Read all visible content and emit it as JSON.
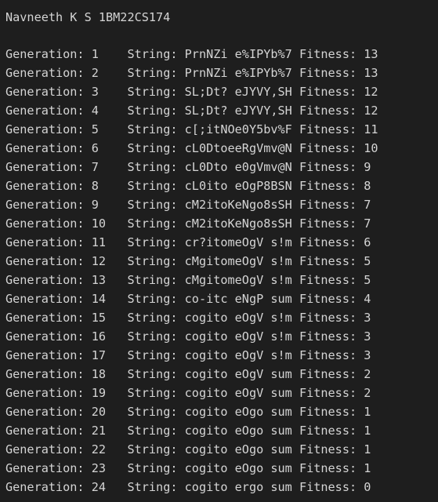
{
  "console": {
    "header": "Navneeth K S 1BM22CS174",
    "rows": [
      {
        "generation": "1",
        "string": "PrnNZi e%IPYb%7",
        "fitness": "13"
      },
      {
        "generation": "2",
        "string": "PrnNZi e%IPYb%7",
        "fitness": "13"
      },
      {
        "generation": "3",
        "string": "SL;Dt? eJYVY,SH",
        "fitness": "12"
      },
      {
        "generation": "4",
        "string": "SL;Dt? eJYVY,SH",
        "fitness": "12"
      },
      {
        "generation": "5",
        "string": "c[;itNOe0Y5bv%F",
        "fitness": "11"
      },
      {
        "generation": "6",
        "string": "cL0DtoeeRgVmv@N",
        "fitness": "10"
      },
      {
        "generation": "7",
        "string": "cL0Dto e0gVmv@N",
        "fitness": "9"
      },
      {
        "generation": "8",
        "string": "cL0ito eOgP8BSN",
        "fitness": "8"
      },
      {
        "generation": "9",
        "string": "cM2itoKeNgo8sSH",
        "fitness": "7"
      },
      {
        "generation": "10",
        "string": "cM2itoKeNgo8sSH",
        "fitness": "7"
      },
      {
        "generation": "11",
        "string": "cr?itomeOgV s!m",
        "fitness": "6"
      },
      {
        "generation": "12",
        "string": "cMgitomeOgV s!m",
        "fitness": "5"
      },
      {
        "generation": "13",
        "string": "cMgitomeOgV s!m",
        "fitness": "5"
      },
      {
        "generation": "14",
        "string": "co-itc eNgP sum",
        "fitness": "4"
      },
      {
        "generation": "15",
        "string": "cogito eOgV s!m",
        "fitness": "3"
      },
      {
        "generation": "16",
        "string": "cogito eOgV s!m",
        "fitness": "3"
      },
      {
        "generation": "17",
        "string": "cogito eOgV s!m",
        "fitness": "3"
      },
      {
        "generation": "18",
        "string": "cogito eOgV sum",
        "fitness": "2"
      },
      {
        "generation": "19",
        "string": "cogito eOgV sum",
        "fitness": "2"
      },
      {
        "generation": "20",
        "string": "cogito eOgo sum",
        "fitness": "1"
      },
      {
        "generation": "21",
        "string": "cogito eOgo sum",
        "fitness": "1"
      },
      {
        "generation": "22",
        "string": "cogito eOgo sum",
        "fitness": "1"
      },
      {
        "generation": "23",
        "string": "cogito eOgo sum",
        "fitness": "1"
      },
      {
        "generation": "24",
        "string": "cogito ergo sum",
        "fitness": "0"
      }
    ],
    "labels": {
      "generation": "Generation:",
      "string": "String:",
      "fitness": "Fitness:"
    }
  },
  "colors": {
    "background": "#1e1e1e",
    "text": "#d4d4d4"
  }
}
